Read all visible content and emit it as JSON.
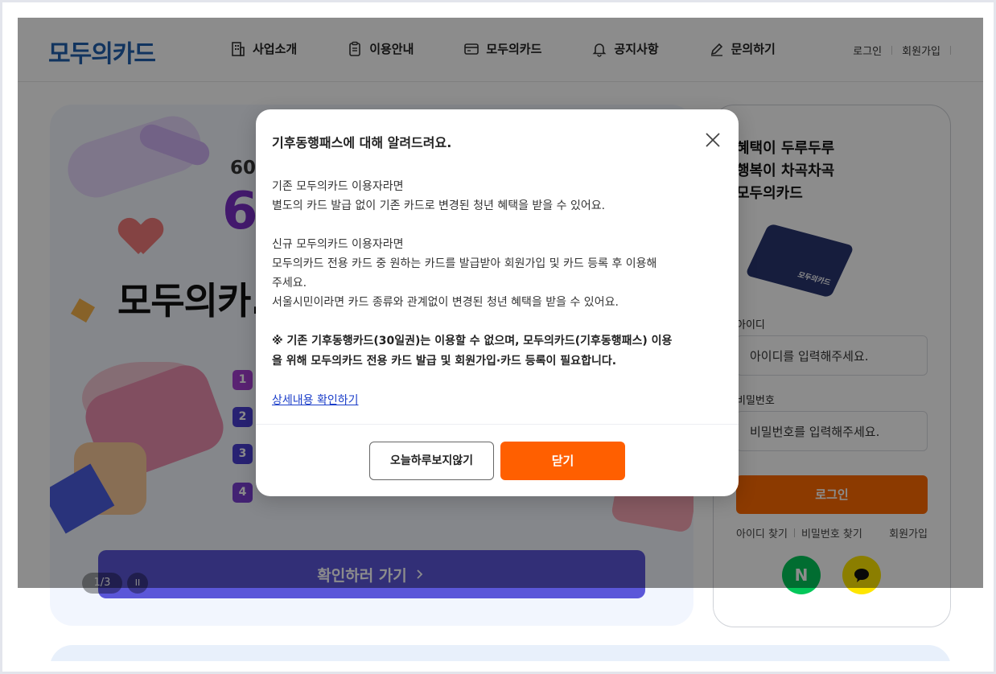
{
  "header": {
    "logo": "모두의카드",
    "nav": [
      {
        "label": "사업소개",
        "icon": "building-icon"
      },
      {
        "label": "이용안내",
        "icon": "clipboard-icon"
      },
      {
        "label": "모두의카드",
        "icon": "card-icon"
      },
      {
        "label": "공지사항",
        "icon": "bell-icon"
      },
      {
        "label": "문의하기",
        "icon": "pencil-icon"
      }
    ],
    "login": "로그인",
    "signup": "회원가입"
  },
  "hero": {
    "small_text": "60",
    "big_text": "6",
    "title": "모두의카.",
    "steps": [
      "1",
      "2",
      "3",
      "4"
    ],
    "cta": "확인하러 가기",
    "pager": "1/3",
    "pause": "II"
  },
  "login_panel": {
    "tagline_1": "혜택이 두루두루",
    "tagline_2": "행복이 차곡차곡",
    "tagline_3": "모두의카드",
    "card_label": "모두의카드",
    "id_label": "아이디",
    "id_placeholder": "아이디를 입력해주세요.",
    "pw_label": "비밀번호",
    "pw_placeholder": "비밀번호를 입력해주세요.",
    "login_button": "로그인",
    "find_id": "아이디 찾기",
    "find_pw": "비밀번호 찾기",
    "signup": "회원가입",
    "naver": "N"
  },
  "modal": {
    "title": "기후동행패스에 대해 알려드려요.",
    "p1_line1": "기존 모두의카드 이용자라면",
    "p1_line2": "별도의 카드 발급 없이 기존 카드로 변경된 청년 혜택을 받을 수 있어요.",
    "p2_line1": "신규 모두의카드 이용자라면",
    "p2_line2": "모두의카드 전용 카드 중 원하는 카드를 발급받아 회원가입 및 카드 등록 후 이용해",
    "p2_line3": "주세요.",
    "p2_line4": "서울시민이라면 카드 종류와 관계없이 변경된 청년 혜택을 받을 수 있어요.",
    "notice_line1": "※ 기존 기후동행카드(30일권)는 이용할 수 없으며, 모두의카드(기후동행패스) 이용",
    "notice_line2": "을 위해 모두의카드 전용 카드 발급 및 회원가입·카드 등록이 필요합니다.",
    "detail_link": "상세내용 확인하기",
    "skip_button": "오늘하루보지않기",
    "close_button": "닫기"
  },
  "colors": {
    "brand": "#1f5fae",
    "accent": "#ff5f00",
    "cta": "#5b57d9"
  }
}
